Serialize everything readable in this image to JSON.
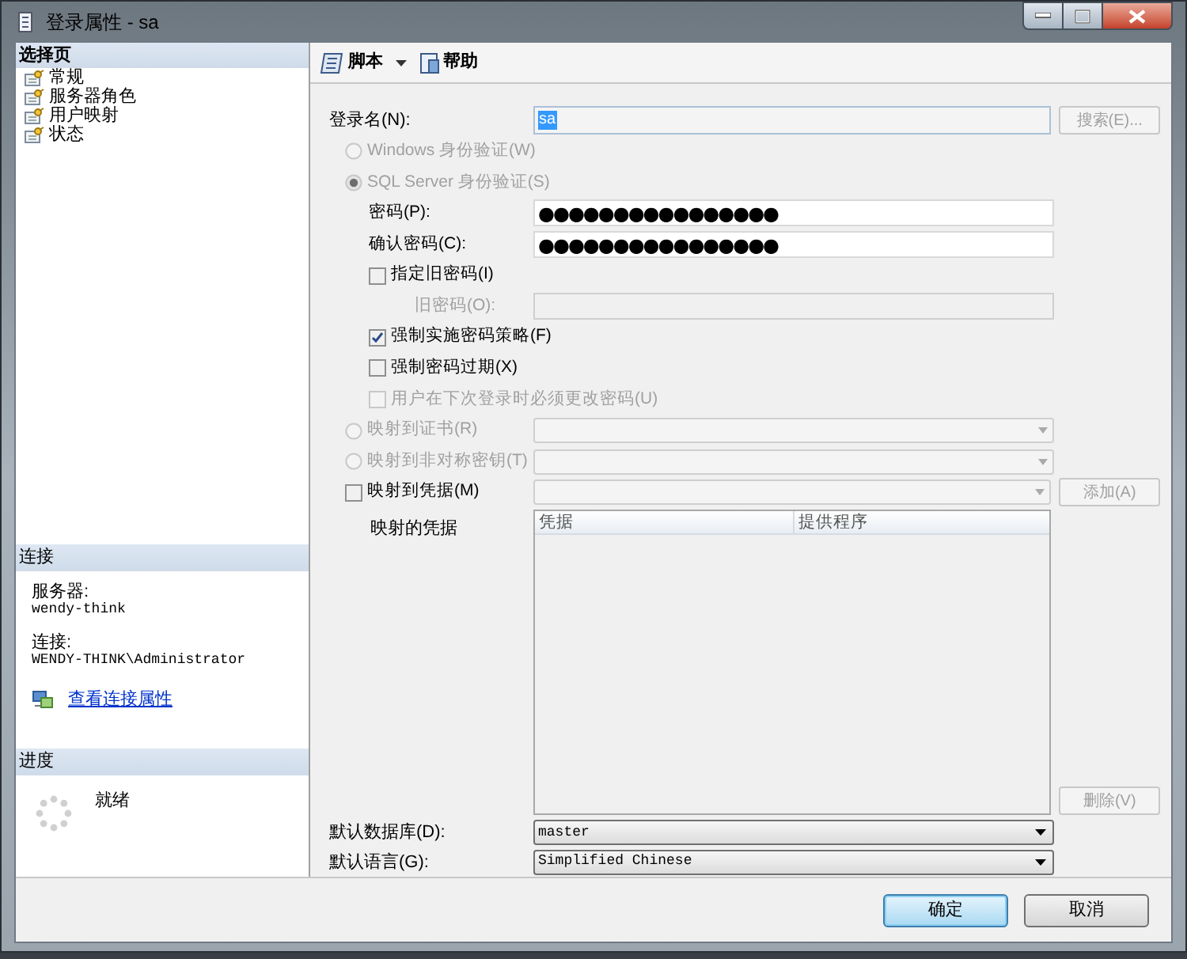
{
  "window": {
    "title": "登录属性 - sa"
  },
  "sidebar": {
    "header": "选择页",
    "pages": [
      {
        "label": "常规",
        "selected": false
      },
      {
        "label": "服务器角色",
        "selected": false
      },
      {
        "label": "用户映射",
        "selected": false
      },
      {
        "label": "状态",
        "selected": false
      }
    ]
  },
  "connection": {
    "header": "连接",
    "server_label": "服务器:",
    "server": "wendy-think",
    "connection_label": "连接:",
    "connection": "WENDY-THINK\\Administrator",
    "link": "查看连接属性"
  },
  "progress": {
    "header": "进度",
    "status": "就绪"
  },
  "toolbar": {
    "script": "脚本",
    "help": "帮助"
  },
  "login_name": {
    "label": "登录名(N):",
    "value": "sa",
    "search_button": "搜索(E)..."
  },
  "rows": [
    {
      "kind": "radio",
      "label": "Windows 身份验证(W)",
      "selected": false,
      "disabled": true
    },
    {
      "kind": "radio",
      "label": "SQL Server 身份验证(S)",
      "selected": true,
      "disabled": true,
      "children": [
        {
          "kind": "password",
          "label": "密码(P):",
          "value": "●●●●●●●●●●●●●●●●",
          "disabled": false
        },
        {
          "kind": "password",
          "label": "确认密码(C):",
          "value": "●●●●●●●●●●●●●●●●",
          "disabled": false
        },
        {
          "kind": "checkbox",
          "label": "指定旧密码(I)",
          "checked": false,
          "disabled": false,
          "children": [
            {
              "kind": "password",
              "label": "旧密码(O):",
              "disabled": true
            }
          ]
        },
        {
          "kind": "checkbox",
          "label": "强制实施密码策略(F)",
          "checked": true,
          "disabled": false
        },
        {
          "kind": "checkbox",
          "label": "强制密码过期(X)",
          "checked": false,
          "disabled": false
        },
        {
          "kind": "checkbox",
          "label": "用户在下次登录时必须更改密码(U)",
          "checked": false,
          "disabled": true
        }
      ]
    },
    {
      "kind": "radio",
      "label": "映射到证书(R)",
      "selected": false,
      "disabled": true,
      "combo": {
        "disabled": true
      }
    },
    {
      "kind": "radio",
      "label": "映射到非对称密钥(T)",
      "selected": false,
      "disabled": true,
      "combo": {
        "disabled": true
      }
    },
    {
      "kind": "checkbox",
      "label": "映射到凭据(M)",
      "checked": false,
      "disabled": false,
      "combo": {
        "disabled": true
      },
      "button": "添加(A)"
    }
  ],
  "credentials": {
    "label": "映射的凭据",
    "columns": [
      "凭据",
      "提供程序"
    ],
    "remove_button": "删除(V)"
  },
  "default_database": {
    "label": "默认数据库(D):",
    "value": "master"
  },
  "default_language": {
    "label": "默认语言(G):",
    "value": "Simplified Chinese"
  },
  "buttons": [
    {
      "label": "确定",
      "default": true
    },
    {
      "label": "取消",
      "default": false
    }
  ]
}
